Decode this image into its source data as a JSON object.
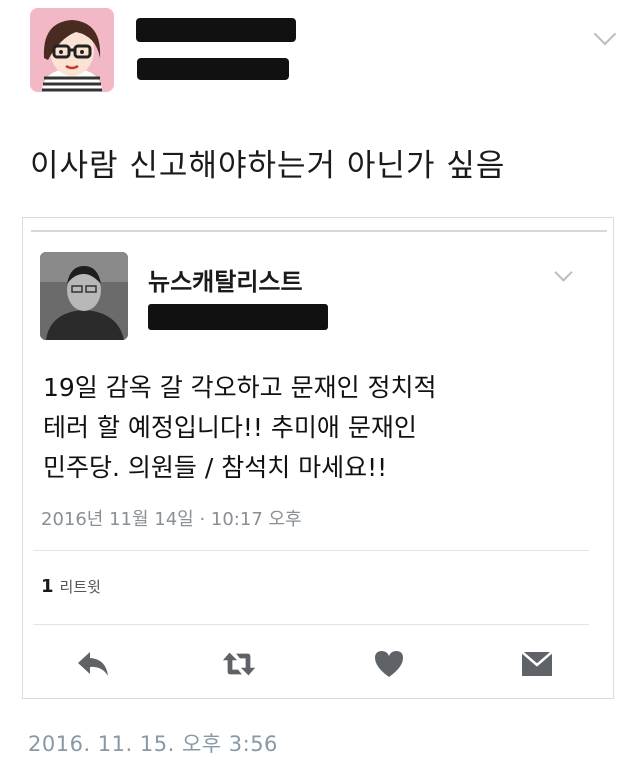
{
  "tweet": {
    "text": "이사람 신고해야하는거 아닌가 싶음",
    "timestamp": "2016. 11. 15. 오후 3:56"
  },
  "quoted": {
    "author_name": "뉴스캐탈리스트",
    "lines": [
      "19일 감옥 갈 각오하고 문재인 정치적",
      "테러 할 예정입니다!! 추미애 문재인",
      "민주당.  의원들 / 참석치 마세요!!"
    ],
    "date": "2016년 11월 14일 · 10:17 오후",
    "retweet_count": "1",
    "retweet_label": "리트윗",
    "actions": [
      "reply-icon",
      "retweet-icon",
      "like-icon",
      "message-icon"
    ]
  },
  "colors": {
    "icon_gray": "#5f6368",
    "meta_gray": "#8899a6",
    "avatar_bg": "#f2b8c6"
  }
}
